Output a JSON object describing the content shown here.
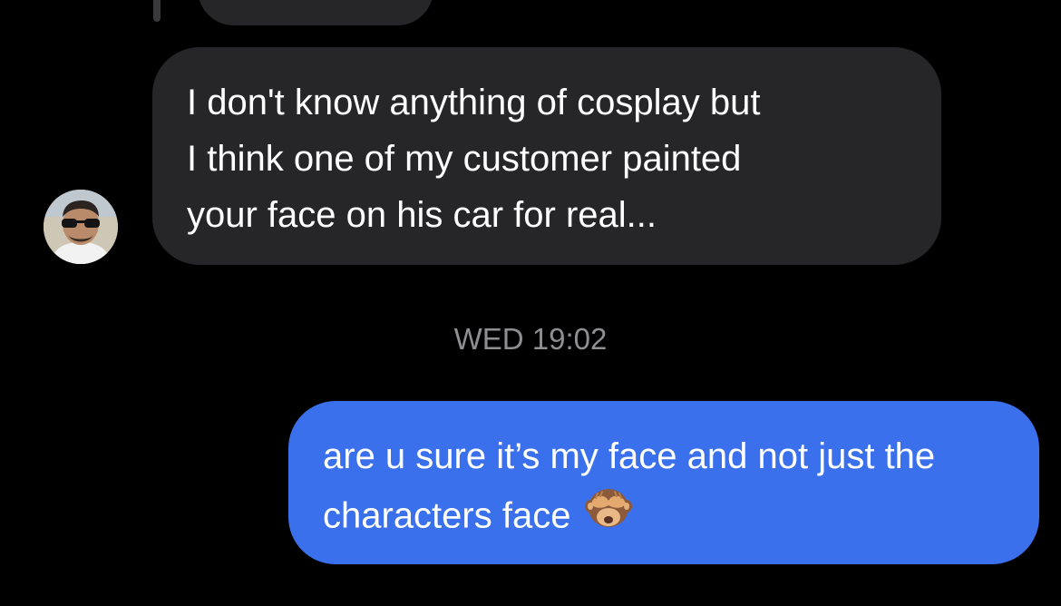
{
  "conversation": {
    "messages": [
      {
        "direction": "incoming",
        "text": "I don't know anything of cosplay but\nI think one of my customer painted\nyour face on his car for real..."
      },
      {
        "direction": "outgoing",
        "text": "are u sure it’s my face and not just the characters face",
        "emoji": "see-no-evil-monkey"
      }
    ],
    "timestamp": "WED 19:02"
  },
  "colors": {
    "background": "#000000",
    "incoming_bubble": "#262628",
    "outgoing_bubble": "#3b70ec",
    "timestamp_text": "#8e8e93"
  },
  "icons": {
    "avatar": "contact-avatar-photo",
    "emoji": "see-no-evil-monkey-icon"
  }
}
